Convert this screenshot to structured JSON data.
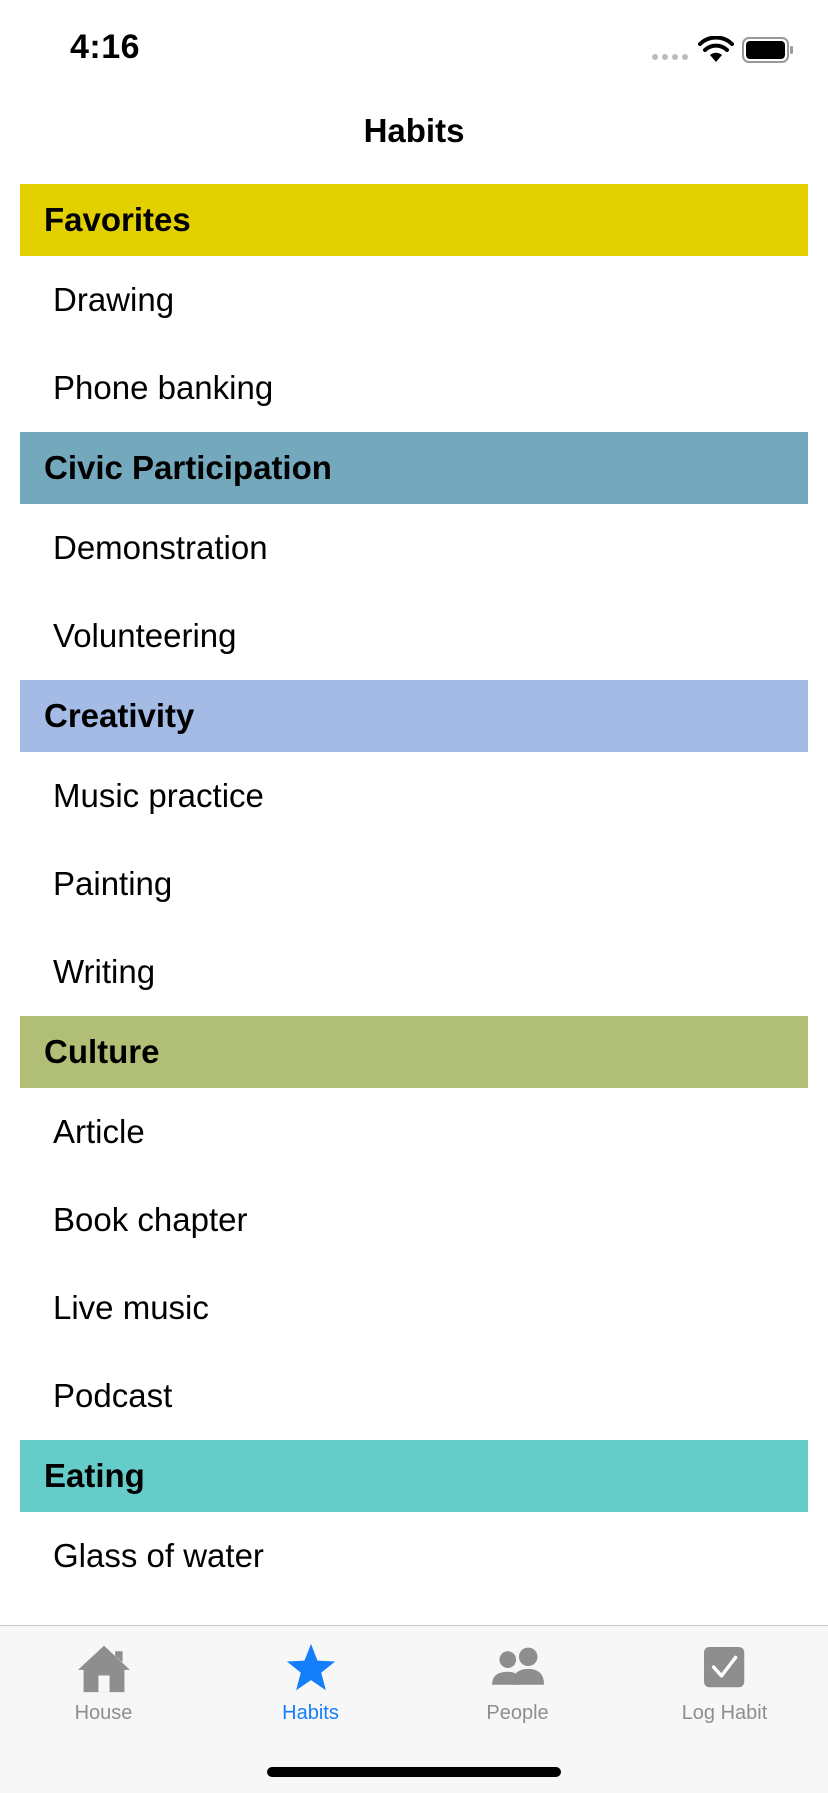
{
  "status_bar": {
    "time": "4:16"
  },
  "nav": {
    "title": "Habits"
  },
  "sections": [
    {
      "title": "Favorites",
      "color": "#e3d000",
      "items": [
        "Drawing",
        "Phone banking"
      ]
    },
    {
      "title": "Civic Participation",
      "color": "#73a8bd",
      "items": [
        "Demonstration",
        "Volunteering"
      ]
    },
    {
      "title": "Creativity",
      "color": "#a3bbe5",
      "items": [
        "Music practice",
        "Painting",
        "Writing"
      ]
    },
    {
      "title": "Culture",
      "color": "#b0bf75",
      "items": [
        "Article",
        "Book chapter",
        "Live music",
        "Podcast"
      ]
    },
    {
      "title": "Eating",
      "color": "#66ccca",
      "items": [
        "Glass of water"
      ]
    }
  ],
  "tabs": [
    {
      "label": "House",
      "icon": "house-icon",
      "active": false
    },
    {
      "label": "Habits",
      "icon": "star-icon",
      "active": true
    },
    {
      "label": "People",
      "icon": "people-icon",
      "active": false
    },
    {
      "label": "Log Habit",
      "icon": "checkmark-icon",
      "active": false
    }
  ],
  "colors": {
    "accent": "#147efb",
    "inactive": "#8e8e8e"
  }
}
